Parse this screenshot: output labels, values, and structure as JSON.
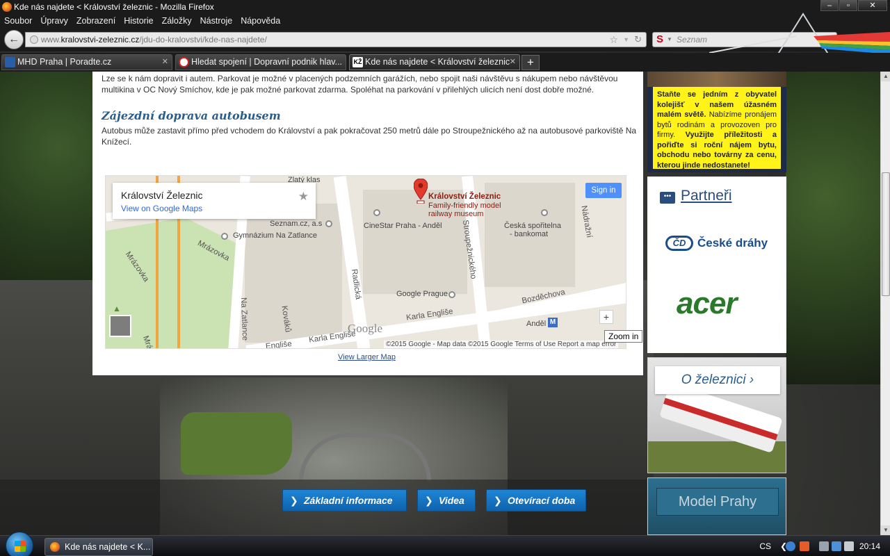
{
  "window": {
    "title": "Kde nás najdete < Království železnic - Mozilla Firefox",
    "controls": [
      "–",
      "▫",
      "✕"
    ]
  },
  "menu": [
    "Soubor",
    "Úpravy",
    "Zobrazení",
    "Historie",
    "Záložky",
    "Nástroje",
    "Nápověda"
  ],
  "urlbar": {
    "prefix": "www.",
    "host": "kralovstvi-zeleznic.cz",
    "path": "/jdu-do-kralovstvi/kde-nas-najdete/"
  },
  "search": {
    "placeholder": "Seznam",
    "engine_glyph": "S"
  },
  "tabs": [
    {
      "label": "MHD Praha | Poradte.cz",
      "active": false
    },
    {
      "label": "Hledat spojení | Dopravní podnik hlav...",
      "active": false
    },
    {
      "label": "Kde nás najdete < Království železnic",
      "active": true
    }
  ],
  "content": {
    "car_paragraph": "Lze se k nám dopravit i autem. Parkovat je možné v placených podzemních garážích, nebo spojit naši návštěvu s nákupem nebo návštěvou multikina v OC Nový Smíchov, kde je pak možné parkovat zdarma. Spoléhat na parkování v přilehlých ulicích není dost dobře možné.",
    "bus_heading": "Zájezdní doprava autobusem",
    "bus_paragraph": "Autobus může zastavit přímo před vchodem do Království a pak pokračovat 250 metrů dále po Stroupežnického až na autobusové parkoviště Na Knížecí.",
    "view_larger_map": "View Larger Map"
  },
  "map": {
    "card_title": "Království Železnic",
    "card_link": "View on Google Maps",
    "sign_in": "Sign in",
    "zoom_in_tooltip": "Zoom in",
    "zoom_plus": "+",
    "google_logo": "Google",
    "attribution": "©2015 Google - Map data ©2015 Google    Terms of Use    Report a map error",
    "pin": {
      "name": "Království Železnic",
      "desc1": "Family-friendly model",
      "desc2": "railway museum"
    },
    "labels": {
      "zlaty_klas": "Zlatý klas",
      "seznam": "Seznam.cz, a.s",
      "gymnazium": "Gymnázium Na Zatlance",
      "cinestar": "CineStar Praha - Anděl",
      "ceska_sporitelna_1": "Česká spořitelna",
      "ceska_sporitelna_2": "- bankomat",
      "google_prague": "Google Prague",
      "andel": "Anděl",
      "mrazovka": "Mrázovka",
      "mrazovka2": "Mrázovka",
      "radlicka": "Radlická",
      "stroupeznickeho": "Stroupežnického",
      "nadrazni": "Nádražní",
      "bozdechova": "Bozděchova",
      "karla_englise": "Karla Engliše",
      "karla_englise2": "Karla Engliše",
      "kovaku": "Kováků",
      "na_zatlance": "Na Zatlance",
      "englise_small": "Engliše",
      "mra": "Mrá"
    }
  },
  "sidebar": {
    "promo_text_1": "Staňte se jedním z obyvatel kolejišť v našem úžasném malém světě.",
    "promo_text_2": " Nabízíme pronájem bytů rodinám a provozoven pro firmy. ",
    "promo_text_3": "Využijte příležitosti a pořiďte si roční nájem bytu, obchodu nebo továrny za cenu, kterou jinde nedostanete!",
    "partners_heading": "Partneři",
    "cd_text": "České dráhy",
    "cd_mark": "ČD",
    "acer": "acer",
    "about_button": "O železnici ›",
    "model_button": "Model Prahy"
  },
  "bottom_nav": [
    {
      "label": "Základní informace"
    },
    {
      "label": "Videa"
    },
    {
      "label": "Otevírací doba"
    }
  ],
  "taskbar": {
    "task_label": "Kde nás najdete < K...",
    "lang": "CS",
    "time": "20:14"
  }
}
